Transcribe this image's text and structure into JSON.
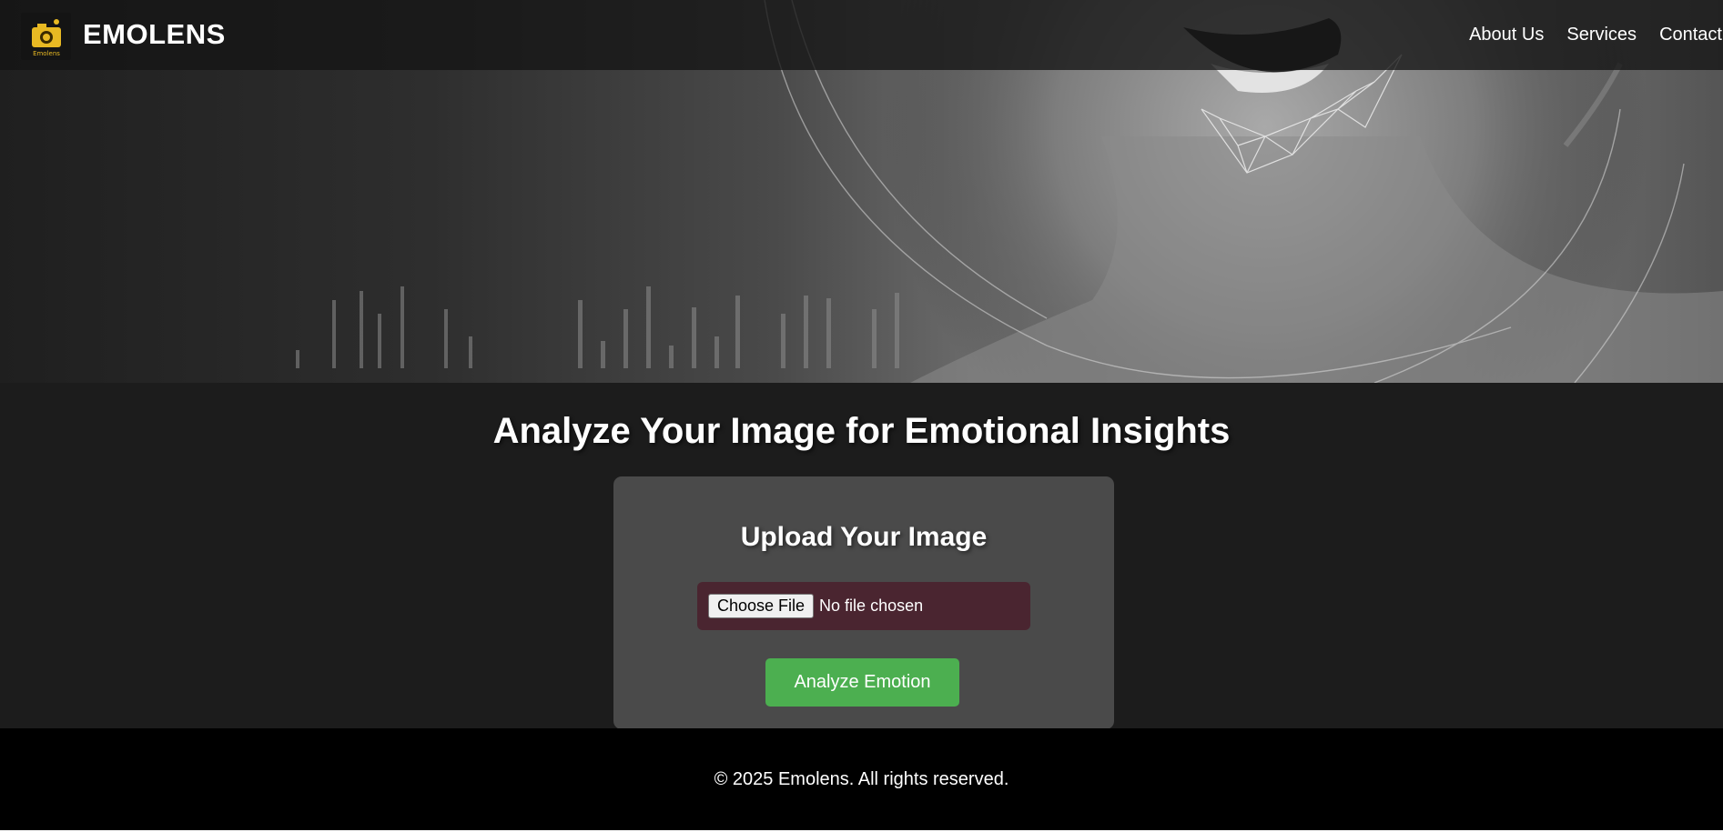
{
  "navbar": {
    "brand": "EMOLENS",
    "logo_caption": "Emolens",
    "links": [
      "About Us",
      "Services",
      "Contact"
    ]
  },
  "hero": {
    "image": "smiling-face-with-facial-recognition-mesh"
  },
  "main": {
    "headline": "Analyze Your Image for Emotional Insights",
    "upload_card": {
      "title": "Upload Your Image",
      "choose_file_label": "Choose File",
      "file_status": "No file chosen",
      "analyze_button": "Analyze Emotion"
    }
  },
  "footer": {
    "copyright": "© 2025 Emolens. All rights reserved."
  },
  "colors": {
    "analyze_button": "#4caf50",
    "file_input_bg": "#4a2530",
    "card_bg": "#4a4a4a",
    "page_bg": "#1c1c1c",
    "footer_bg": "#000000",
    "logo_accent": "#e8b923"
  }
}
